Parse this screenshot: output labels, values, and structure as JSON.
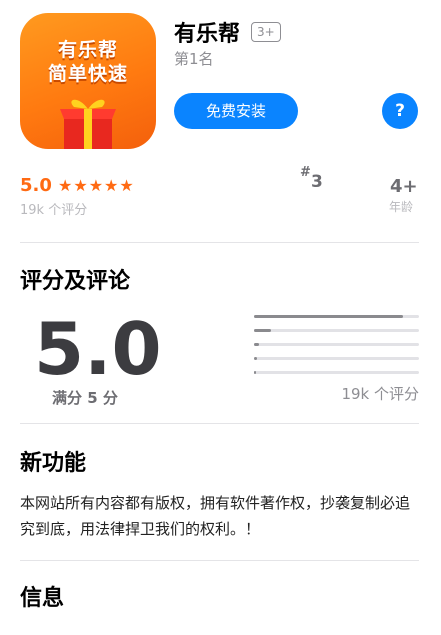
{
  "app": {
    "icon_line1": "有乐帮",
    "icon_line2": "简单快速",
    "title": "有乐帮",
    "age_badge": "3+",
    "rank_label": "第1名",
    "install_label": "免费安装",
    "help_label": "?"
  },
  "stats": {
    "rating": "5.0",
    "stars": "★★★★★",
    "rating_count": "19k 个评分",
    "rank_hash": "#",
    "rank_number": "3",
    "age": "4+",
    "age_label": "年龄"
  },
  "ratings_section": {
    "title": "评分及评论",
    "score": "5.0",
    "out_of": "满分 5 分",
    "total": "19k 个评分",
    "distribution": [
      {
        "stars": 5,
        "fraction": 0.9
      },
      {
        "stars": 4,
        "fraction": 0.1
      },
      {
        "stars": 3,
        "fraction": 0.03
      },
      {
        "stars": 2,
        "fraction": 0.02
      },
      {
        "stars": 1,
        "fraction": 0.01
      }
    ]
  },
  "whats_new": {
    "title": "新功能",
    "text": "本网站所有内容都有版权，拥有软件著作权，抄袭复制必追究到底，用法律捍卫我们的权利。！"
  },
  "info": {
    "title": "信息"
  },
  "colors": {
    "accent": "#0a84ff",
    "rating_orange": "#ff6a13",
    "icon_orange": "#ff7a10"
  }
}
